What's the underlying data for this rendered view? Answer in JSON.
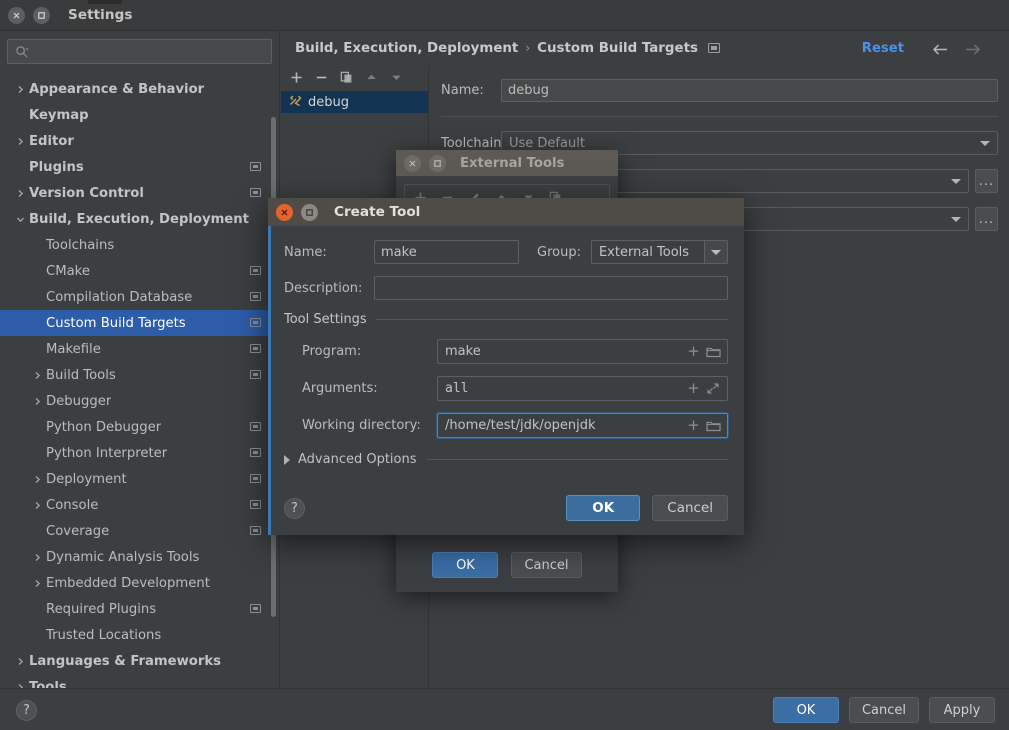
{
  "window": {
    "title": "Settings",
    "close_icon": "close-icon",
    "maximize_icon": "maximize-icon"
  },
  "search": {
    "value": "",
    "placeholder": "",
    "icon": "search-icon"
  },
  "sidebar": {
    "items": [
      {
        "label": "Appearance & Behavior",
        "level": 0,
        "bold": true,
        "arrow": "chevron-right",
        "badge": false,
        "selected": false
      },
      {
        "label": "Keymap",
        "level": 0,
        "bold": true,
        "arrow": "",
        "badge": false,
        "selected": false
      },
      {
        "label": "Editor",
        "level": 0,
        "bold": true,
        "arrow": "chevron-right",
        "badge": false,
        "selected": false
      },
      {
        "label": "Plugins",
        "level": 0,
        "bold": true,
        "arrow": "",
        "badge": true,
        "selected": false
      },
      {
        "label": "Version Control",
        "level": 0,
        "bold": true,
        "arrow": "chevron-right",
        "badge": true,
        "selected": false
      },
      {
        "label": "Build, Execution, Deployment",
        "level": 0,
        "bold": true,
        "arrow": "chevron-down",
        "badge": false,
        "selected": false
      },
      {
        "label": "Toolchains",
        "level": 1,
        "bold": false,
        "arrow": "",
        "badge": false,
        "selected": false
      },
      {
        "label": "CMake",
        "level": 1,
        "bold": false,
        "arrow": "",
        "badge": true,
        "selected": false
      },
      {
        "label": "Compilation Database",
        "level": 1,
        "bold": false,
        "arrow": "",
        "badge": true,
        "selected": false
      },
      {
        "label": "Custom Build Targets",
        "level": 1,
        "bold": false,
        "arrow": "",
        "badge": true,
        "selected": true
      },
      {
        "label": "Makefile",
        "level": 1,
        "bold": false,
        "arrow": "",
        "badge": true,
        "selected": false
      },
      {
        "label": "Build Tools",
        "level": 1,
        "bold": false,
        "arrow": "chevron-right",
        "badge": true,
        "selected": false
      },
      {
        "label": "Debugger",
        "level": 1,
        "bold": false,
        "arrow": "chevron-right",
        "badge": false,
        "selected": false
      },
      {
        "label": "Python Debugger",
        "level": 1,
        "bold": false,
        "arrow": "",
        "badge": true,
        "selected": false
      },
      {
        "label": "Python Interpreter",
        "level": 1,
        "bold": false,
        "arrow": "",
        "badge": true,
        "selected": false
      },
      {
        "label": "Deployment",
        "level": 1,
        "bold": false,
        "arrow": "chevron-right",
        "badge": true,
        "selected": false
      },
      {
        "label": "Console",
        "level": 1,
        "bold": false,
        "arrow": "chevron-right",
        "badge": true,
        "selected": false
      },
      {
        "label": "Coverage",
        "level": 1,
        "bold": false,
        "arrow": "",
        "badge": true,
        "selected": false
      },
      {
        "label": "Dynamic Analysis Tools",
        "level": 1,
        "bold": false,
        "arrow": "chevron-right",
        "badge": false,
        "selected": false
      },
      {
        "label": "Embedded Development",
        "level": 1,
        "bold": false,
        "arrow": "chevron-right",
        "badge": false,
        "selected": false
      },
      {
        "label": "Required Plugins",
        "level": 1,
        "bold": false,
        "arrow": "",
        "badge": true,
        "selected": false
      },
      {
        "label": "Trusted Locations",
        "level": 1,
        "bold": false,
        "arrow": "",
        "badge": false,
        "selected": false
      },
      {
        "label": "Languages & Frameworks",
        "level": 0,
        "bold": true,
        "arrow": "chevron-right",
        "badge": false,
        "selected": false
      },
      {
        "label": "Tools",
        "level": 0,
        "bold": true,
        "arrow": "chevron-right",
        "badge": false,
        "selected": false
      }
    ]
  },
  "breadcrumb": {
    "root": "Build, Execution, Deployment",
    "separator": "›",
    "leaf": "Custom Build Targets",
    "badge_icon": "settings-sync-icon",
    "reset_label": "Reset",
    "back_icon": "arrow-left-icon",
    "forward_icon": "arrow-right-icon"
  },
  "targets": {
    "toolbar": [
      {
        "icon": "plus-icon",
        "dim": false
      },
      {
        "icon": "minus-icon",
        "dim": false
      },
      {
        "icon": "copy-icon",
        "dim": false
      },
      {
        "icon": "move-up-icon",
        "dim": true
      },
      {
        "icon": "move-down-icon",
        "dim": true
      }
    ],
    "items": [
      {
        "label": "debug",
        "icon": "tools-icon",
        "selected": true
      }
    ]
  },
  "target_form": {
    "name_label": "Name:",
    "name_value": "debug",
    "toolchain_label": "Toolchain:",
    "toolchain_value": "Use Default",
    "build_value": "",
    "clean_value": "",
    "dots_label": "..."
  },
  "external_tools_dialog": {
    "title": "External Tools",
    "close_icon": "close-icon",
    "maximize_icon": "maximize-icon",
    "toolbar": [
      {
        "icon": "plus-icon"
      },
      {
        "icon": "minus-icon"
      },
      {
        "icon": "edit-pencil-icon"
      },
      {
        "icon": "move-up-icon"
      },
      {
        "icon": "move-down-icon"
      },
      {
        "icon": "copy-icon"
      }
    ],
    "ok_label": "OK",
    "cancel_label": "Cancel"
  },
  "create_tool_dialog": {
    "title": "Create Tool",
    "close_icon": "close-icon",
    "maximize_icon": "maximize-icon",
    "name_label": "Name:",
    "name_value": "make",
    "group_label": "Group:",
    "group_value": "External Tools",
    "group_caret_icon": "chevron-down-icon",
    "description_label": "Description:",
    "description_value": "",
    "tool_settings_label": "Tool Settings",
    "program_label": "Program:",
    "program_value": "make",
    "arguments_label": "Arguments:",
    "arguments_value": "all",
    "working_directory_label": "Working directory:",
    "working_directory_value": "/home/test/jdk/openjdk",
    "insert_macro_icon": "plus-icon",
    "browse_icon": "folder-icon",
    "expand_icon": "expand-icon",
    "advanced_options_label": "Advanced Options",
    "advanced_expand_icon": "triangle-right-icon",
    "help_label": "?",
    "ok_label": "OK",
    "cancel_label": "Cancel"
  },
  "footer": {
    "help_label": "?",
    "ok_label": "OK",
    "cancel_label": "Cancel",
    "apply_label": "Apply"
  },
  "colors": {
    "window_bg": "#3c3f41",
    "selection_blue": "#2f63c4",
    "accent_link": "#4a93e8",
    "primary_button": "#3a6ea5",
    "dialog_close_orange": "#e8622b",
    "focus_border": "#4a86c8"
  }
}
